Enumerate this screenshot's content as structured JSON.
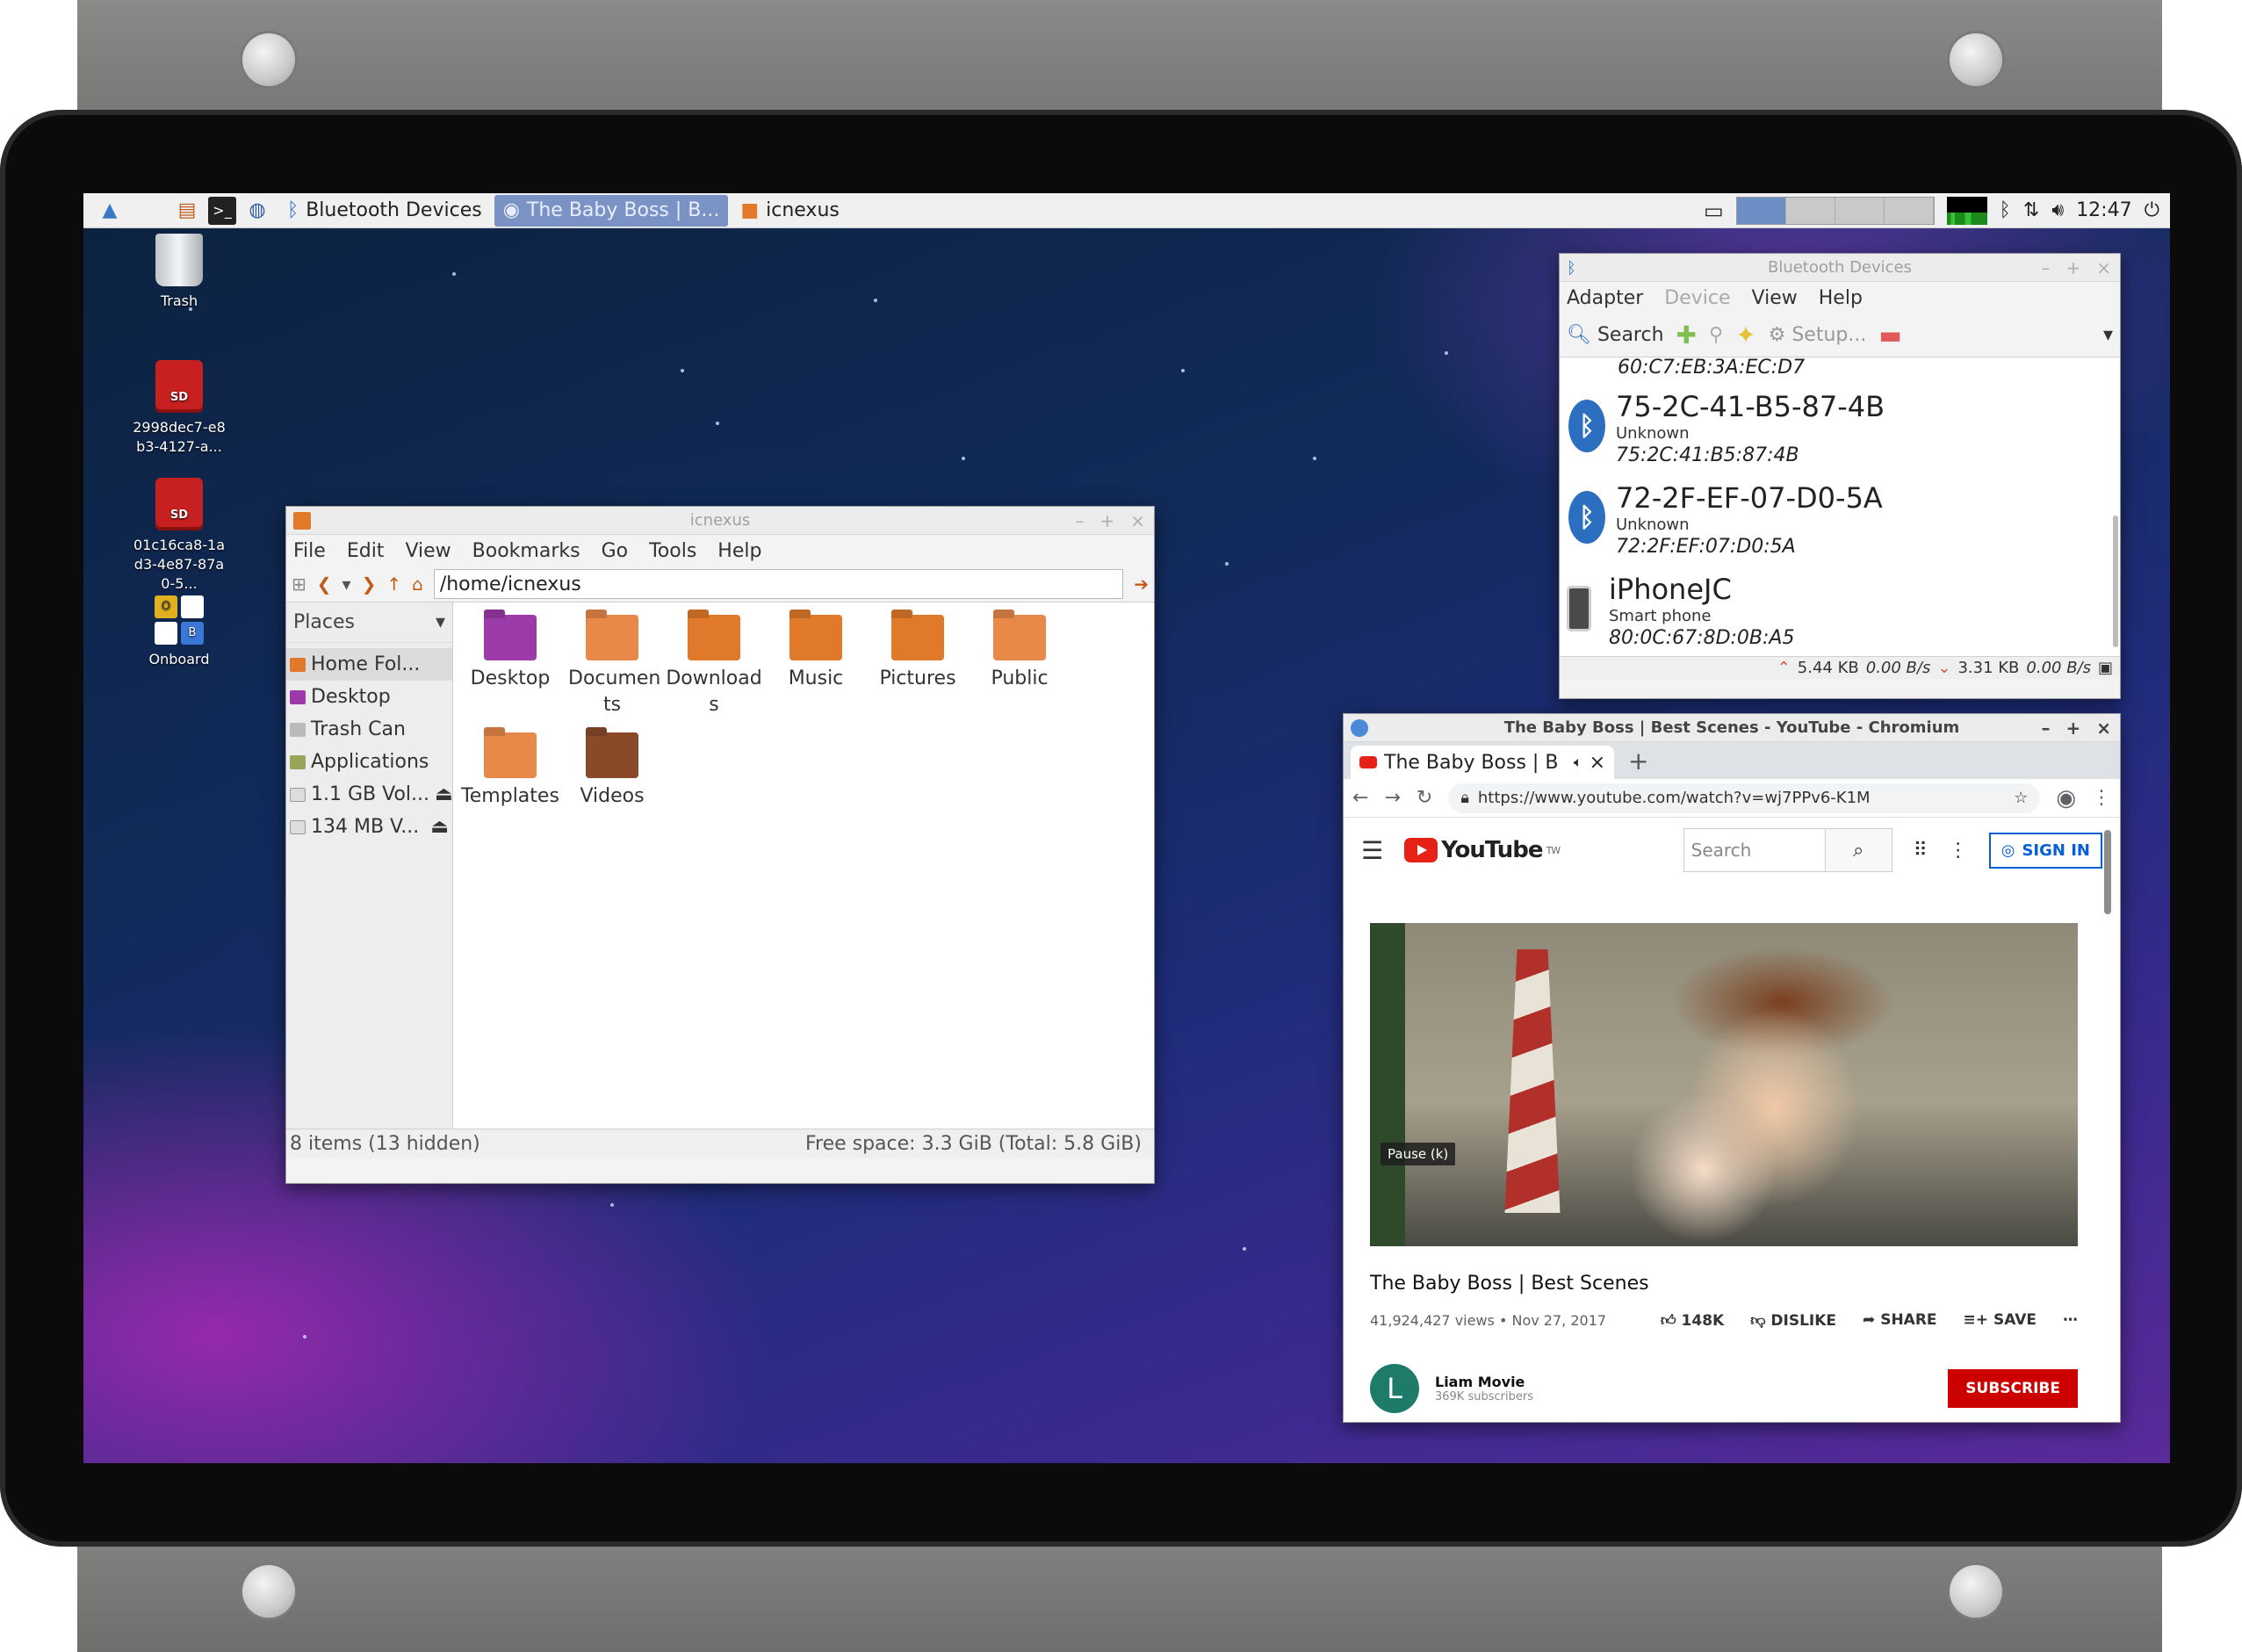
{
  "panel": {
    "tasks": [
      {
        "label": "Bluetooth Devices"
      },
      {
        "label": "The Baby Boss | B..."
      },
      {
        "label": "icnexus"
      }
    ],
    "clock": "12:47"
  },
  "desktop": {
    "icons": [
      {
        "label": "Trash"
      },
      {
        "label": "2998dec7-e8b3-4127-a..."
      },
      {
        "label": "01c16ca8-1ad3-4e87-87a0-5..."
      },
      {
        "label": "Onboard"
      }
    ],
    "sd_label": "SD",
    "onboard_letters": [
      "O",
      "",
      "",
      "B"
    ]
  },
  "file_manager": {
    "title": "icnexus",
    "menu": [
      "File",
      "Edit",
      "View",
      "Bookmarks",
      "Go",
      "Tools",
      "Help"
    ],
    "path": "/home/icnexus",
    "places_header": "Places",
    "places": [
      "Home Fol...",
      "Desktop",
      "Trash Can",
      "Applications",
      "1.1 GB Vol...",
      "134 MB V..."
    ],
    "folders": [
      "Desktop",
      "Documen ts",
      "Download s",
      "Music",
      "Pictures",
      "Public",
      "Templates",
      "Videos"
    ],
    "status_left": "8 items (13 hidden)",
    "status_right": "Free space: 3.3 GiB (Total: 5.8 GiB)"
  },
  "bluetooth": {
    "title": "Bluetooth Devices",
    "menu": [
      "Adapter",
      "Device",
      "View",
      "Help"
    ],
    "toolbar": {
      "search": "Search",
      "setup": "Setup..."
    },
    "partial_mac": "60:C7:EB:3A:EC:D7",
    "devices": [
      {
        "name": "75-2C-41-B5-87-4B",
        "type": "Unknown",
        "mac": "75:2C:41:B5:87:4B"
      },
      {
        "name": "72-2F-EF-07-D0-5A",
        "type": "Unknown",
        "mac": "72:2F:EF:07:D0:5A"
      },
      {
        "name": "iPhoneJC",
        "type": "Smart phone",
        "mac": "80:0C:67:8D:0B:A5"
      }
    ],
    "status": {
      "down_total": "5.44 KB",
      "down_rate": "0.00 B/s",
      "up_total": "3.31 KB",
      "up_rate": "0.00 B/s"
    }
  },
  "chromium": {
    "title": "The Baby Boss | Best Scenes - YouTube - Chromium",
    "tab_label": "The Baby Boss | B",
    "url": "https://www.youtube.com/watch?v=wj7PPv6-K1M",
    "youtube": {
      "logo": "YouTube",
      "logo_sup": "TW",
      "search_placeholder": "Search",
      "sign_in": "SIGN IN",
      "tooltip": "Pause (k)",
      "video_title": "The Baby Boss | Best Scenes",
      "views": "41,924,427 views • Nov 27, 2017",
      "likes": "148K",
      "dislike": "DISLIKE",
      "share": "SHARE",
      "save": "SAVE",
      "channel_initial": "L",
      "channel": "Liam Movie",
      "subscribers": "369K subscribers",
      "subscribe": "SUBSCRIBE"
    }
  },
  "colors": {
    "panel_active": "#7a93c4",
    "youtube_red": "#cc0000",
    "link_blue": "#065fd4"
  }
}
